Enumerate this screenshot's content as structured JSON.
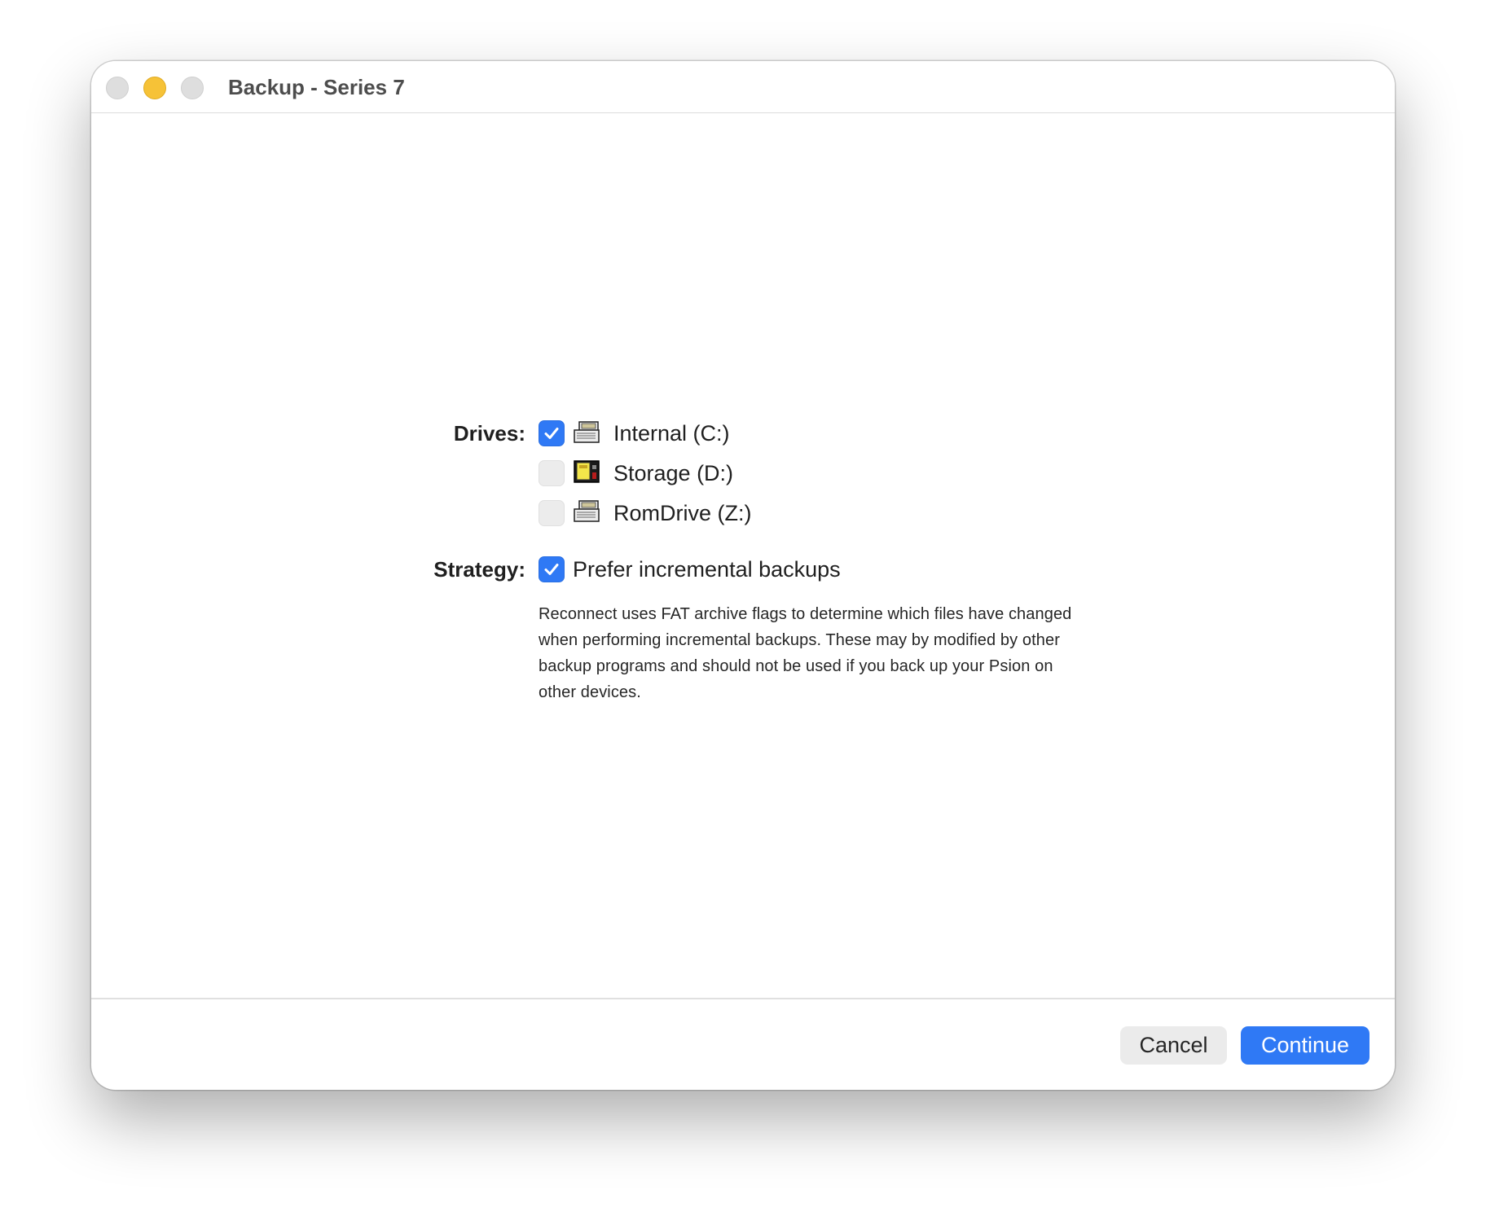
{
  "window": {
    "title": "Backup - Series 7"
  },
  "drives": {
    "label": "Drives:",
    "items": [
      {
        "label": "Internal (C:)",
        "checked": true,
        "icon": "internal-drive-icon"
      },
      {
        "label": "Storage (D:)",
        "checked": false,
        "icon": "storage-card-icon"
      },
      {
        "label": "RomDrive (Z:)",
        "checked": false,
        "icon": "rom-drive-icon"
      }
    ]
  },
  "strategy": {
    "label": "Strategy:",
    "option_label": "Prefer incremental backups",
    "checked": true,
    "description": "Reconnect uses FAT archive flags to determine which files have changed when performing incremental backups. These may by modified by other backup programs and should not be used if you back up your Psion on other devices."
  },
  "footer": {
    "cancel_label": "Cancel",
    "continue_label": "Continue"
  },
  "colors": {
    "accent": "#2f79f5",
    "minimize": "#f6c237"
  }
}
